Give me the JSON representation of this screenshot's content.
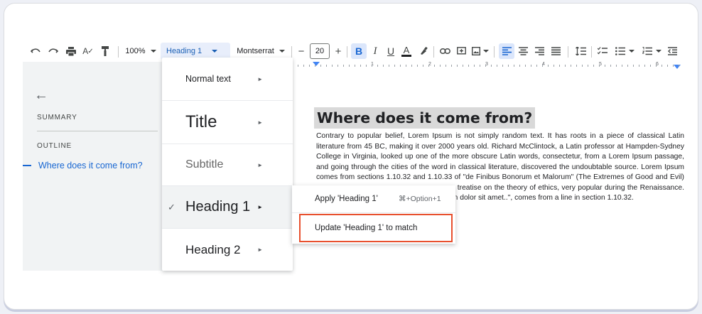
{
  "toolbar": {
    "icons": [
      "undo-icon",
      "redo-icon",
      "print-icon",
      "spellcheck-icon",
      "paint-format-icon"
    ],
    "zoom": "100%",
    "style_value": "Heading 1",
    "font_value": "Montserrat",
    "font_size": "20",
    "minus": "−",
    "plus": "+",
    "bold": "B",
    "italic": "I",
    "underline": "U",
    "text_color": "A"
  },
  "sidebar": {
    "back": "←",
    "summary_label": "SUMMARY",
    "outline_label": "OUTLINE",
    "outline_items": [
      "Where does it come from?"
    ]
  },
  "ruler": {
    "numbers": [
      "1",
      "2",
      "3",
      "4",
      "5",
      "6"
    ]
  },
  "document": {
    "title": "Where does it come from?",
    "body": "Contrary to popular belief, Lorem Ipsum is not simply random text. It has roots in a piece of classical Latin literature from 45 BC, making it over 2000 years old. Richard McClintock, a Latin professor at Hampden-Sydney College in Virginia, looked up one of the more obscure Latin words, consectetur, from a Lorem Ipsum passage, and going through the cities of the word in classical literature, discovered the undoubtable source. Lorem Ipsum comes from sections 1.10.32 and 1.10.33 of \"de Finibus Bonorum et Malorum\" (The Extremes of Good and Evil) by Cicero, written in 45 BC. This book is a treatise on the theory of ethics, very popular during the Renaissance. The first line of Lorem Ipsum, \"Lorem ipsum dolor sit amet..\", comes from a line in section 1.10.32."
  },
  "style_menu": {
    "items": [
      {
        "label": "Normal text",
        "arrow": "►"
      },
      {
        "label": "Title",
        "arrow": "►"
      },
      {
        "label": "Subtitle",
        "arrow": "►"
      },
      {
        "label": "Heading 1",
        "arrow": "►",
        "check": "✓"
      },
      {
        "label": "Heading 2",
        "arrow": "►"
      }
    ]
  },
  "submenu": {
    "apply_label": "Apply 'Heading 1'",
    "apply_shortcut": "⌘+Option+1",
    "update_label": "Update 'Heading 1' to match"
  },
  "colors": {
    "accent": "#1967d2",
    "highlight_border": "#e8502e",
    "selected_bg": "#e8eefb"
  }
}
